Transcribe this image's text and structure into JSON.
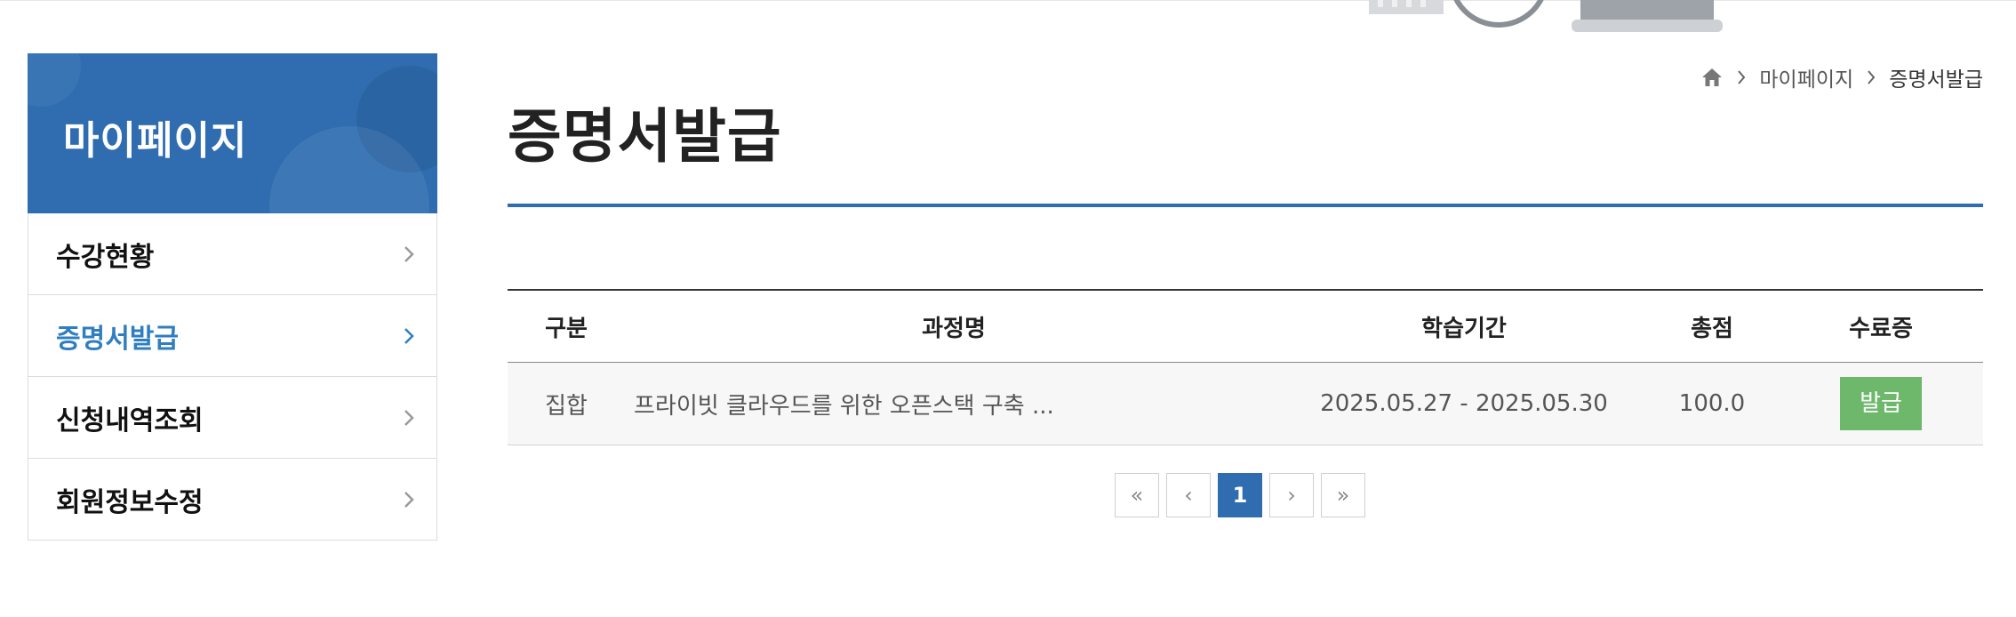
{
  "sidebar": {
    "title": "마이페이지",
    "items": [
      {
        "label": "수강현황"
      },
      {
        "label": "증명서발급"
      },
      {
        "label": "신청내역조회"
      },
      {
        "label": "회원정보수정"
      }
    ]
  },
  "breadcrumb": {
    "home_icon": "home-icon",
    "items": [
      "마이페이지",
      "증명서발급"
    ]
  },
  "page": {
    "title": "증명서발급"
  },
  "table": {
    "headers": [
      "구분",
      "과정명",
      "학습기간",
      "총점",
      "수료증"
    ],
    "rows": [
      {
        "type": "집합",
        "course": "프라이빗 클라우드를 위한 오픈스택 구축 ...",
        "period": "2025.05.27 - 2025.05.30",
        "score": "100.0",
        "action": "발급"
      }
    ]
  },
  "pagination": {
    "first": "«",
    "prev": "‹",
    "current": "1",
    "next": "›",
    "last": "»"
  },
  "colors": {
    "primary": "#2f6db0",
    "active_text": "#2f7ec1",
    "issue_button": "#6db86a"
  }
}
